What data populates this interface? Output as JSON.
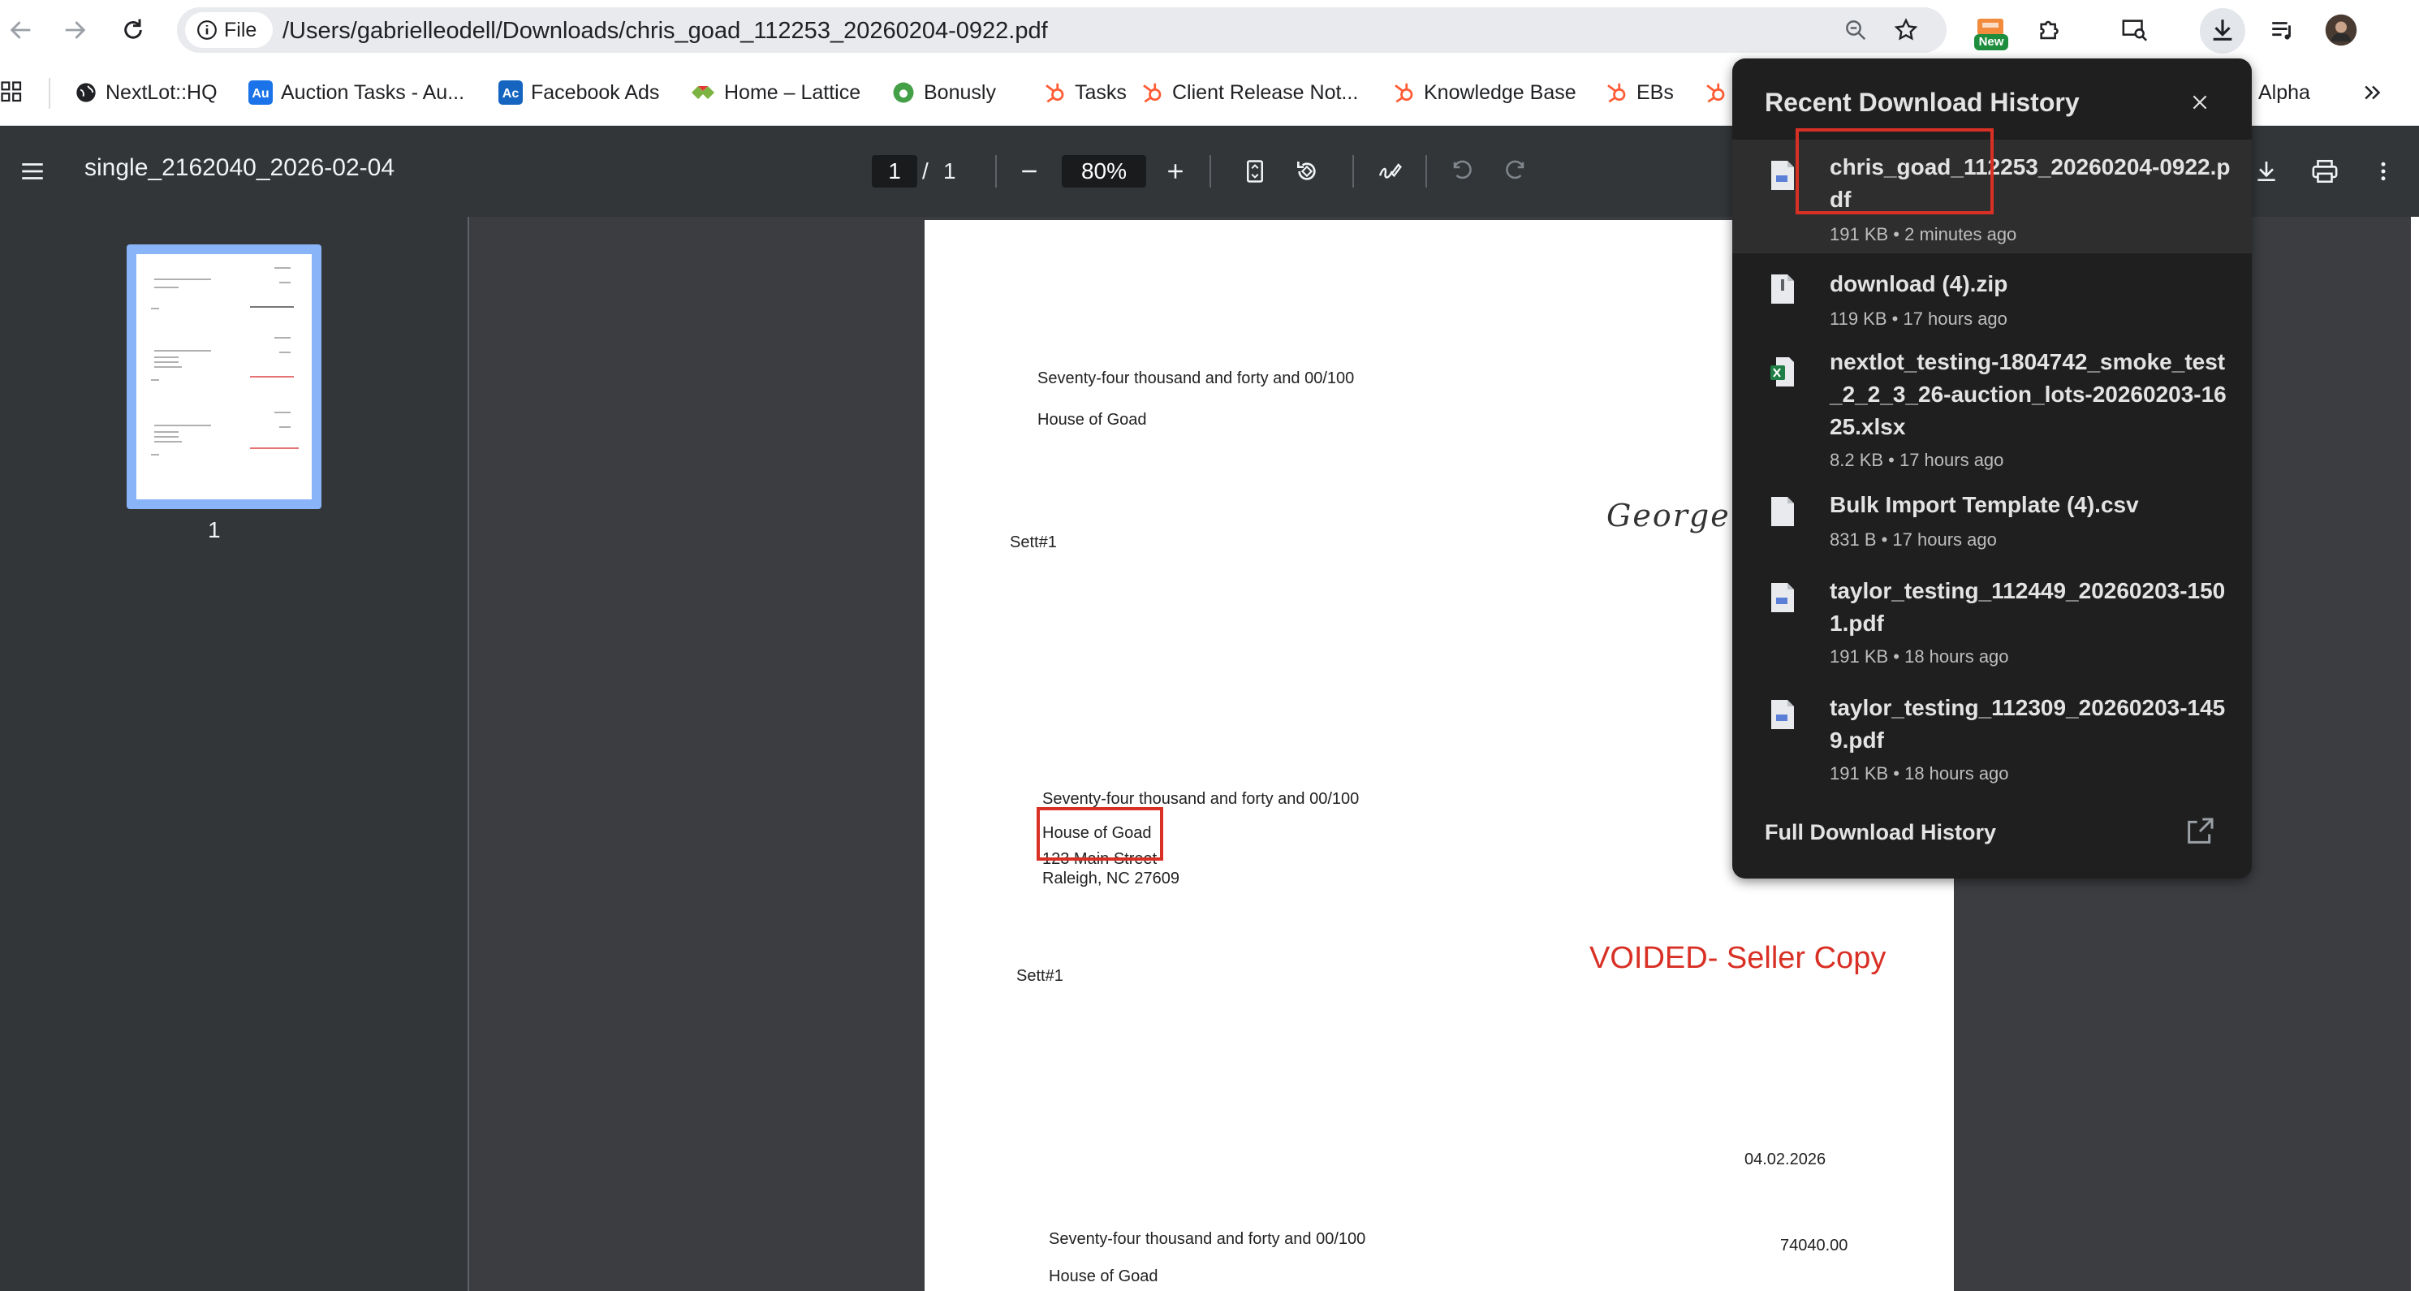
{
  "browser": {
    "url": "/Users/gabrielleodell/Downloads/chris_goad_112253_20260204-0922.pdf",
    "chip_label": "File",
    "new_badge": "New"
  },
  "bookmarks": [
    {
      "label": "NextLot::HQ",
      "icon": "globe-icon",
      "color": "#202124"
    },
    {
      "label": "Auction Tasks - Au...",
      "icon": "au-icon",
      "color": "#1a73e8"
    },
    {
      "label": "Facebook Ads",
      "icon": "ac-icon",
      "color": "#1565c0"
    },
    {
      "label": "Home – Lattice",
      "icon": "lattice-icon",
      "color": "#2e7d32"
    },
    {
      "label": "Bonusly",
      "icon": "bonusly-icon",
      "color": "#43a047"
    },
    {
      "label": "Tasks",
      "icon": "hubspot-icon",
      "color": "#ff5c35"
    },
    {
      "label": "Client Release Not...",
      "icon": "hubspot-icon",
      "color": "#ff5c35"
    },
    {
      "label": "Knowledge Base",
      "icon": "hubspot-icon",
      "color": "#ff5c35"
    },
    {
      "label": "EBs",
      "icon": "hubspot-icon",
      "color": "#ff5c35"
    },
    {
      "label": "Alpha",
      "icon": "hubspot-icon",
      "color": "#ff5c35"
    }
  ],
  "pdf_toolbar": {
    "title": "single_2162040_2026-02-04",
    "page_current": "1",
    "page_separator": "/",
    "page_total": "1",
    "zoom": "80%"
  },
  "sidebar": {
    "thumbnail_number": "1"
  },
  "document": {
    "block1": {
      "amount_words": "Seventy-four thousand and forty and 00/100",
      "payee": "House of Goad",
      "memo": "Sett#1",
      "signature": "George W"
    },
    "block2": {
      "amount_words": "Seventy-four thousand and forty and 00/100",
      "payee": "House of Goad",
      "address1": "123 Main Street",
      "address2": "Raleigh, NC 27609",
      "memo": "Sett#1",
      "stamp": "VOIDED- Seller Copy"
    },
    "block3": {
      "date": "04.02.2026",
      "amount_words": "Seventy-four thousand and forty and 00/100",
      "amount": "74040.00",
      "payee": "House of Goad"
    }
  },
  "download_panel": {
    "title": "Recent Download History",
    "items": [
      {
        "name": "chris_goad_112253_20260204-0922.pdf",
        "meta": "191 KB • 2 minutes ago",
        "icon": "pdf-file-icon"
      },
      {
        "name": "download (4).zip",
        "meta": "119 KB • 17 hours ago",
        "icon": "zip-file-icon"
      },
      {
        "name": "nextlot_testing-1804742_smoke_test_2_2_3_26-auction_lots-20260203-1625.xlsx",
        "meta": "8.2 KB • 17 hours ago",
        "icon": "excel-file-icon"
      },
      {
        "name": "Bulk Import Template (4).csv",
        "meta": "831 B • 17 hours ago",
        "icon": "csv-file-icon"
      },
      {
        "name": "taylor_testing_112449_20260203-1501.pdf",
        "meta": "191 KB • 18 hours ago",
        "icon": "pdf-file-icon"
      },
      {
        "name": "taylor_testing_112309_20260203-1459.pdf",
        "meta": "191 KB • 18 hours ago",
        "icon": "pdf-file-icon"
      }
    ],
    "footer_link": "Full Download History"
  },
  "colors": {
    "highlight_box": "#d93025",
    "pdf_toolbar_bg": "#323639",
    "panel_bg": "#1f1f1f",
    "thumbnail_border": "#8ab4f8"
  }
}
